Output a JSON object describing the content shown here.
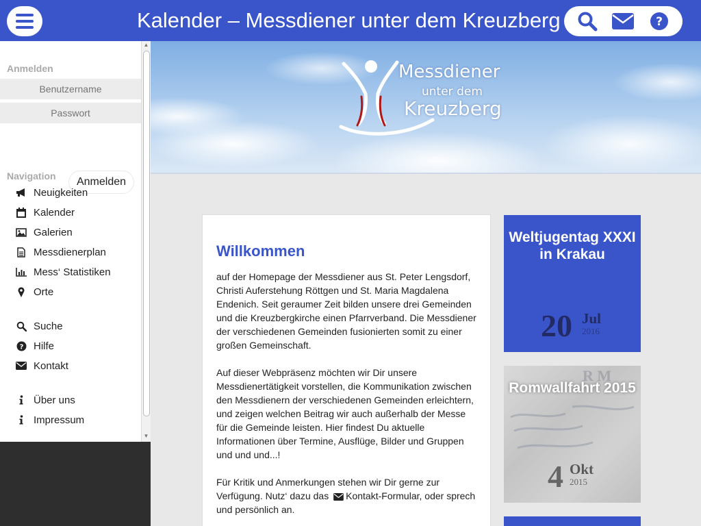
{
  "header": {
    "title": "Kalender – Messdiener unter dem Kreuzberg",
    "menu_icon": "bars-icon",
    "actions": [
      {
        "icon": "search-icon"
      },
      {
        "icon": "envelope-icon"
      },
      {
        "icon": "question-circle-icon"
      }
    ]
  },
  "sidebar": {
    "login_section": "Anmelden",
    "username_placeholder": "Benutzername",
    "password_placeholder": "Passwort",
    "login_button": "Anmelden",
    "nav_section": "Navigation",
    "items": [
      {
        "label": "Neuigkeiten",
        "icon": "bullhorn-icon"
      },
      {
        "label": "Kalender",
        "icon": "calendar-icon"
      },
      {
        "label": "Galerien",
        "icon": "image-icon"
      },
      {
        "label": "Messdienerplan",
        "icon": "file-text-icon"
      },
      {
        "label": "Mess‘ Statistiken",
        "icon": "bar-chart-icon"
      },
      {
        "label": "Orte",
        "icon": "map-marker-icon"
      },
      {
        "label": "Suche",
        "icon": "search-icon"
      },
      {
        "label": "Hilfe",
        "icon": "question-circle-icon"
      },
      {
        "label": "Kontakt",
        "icon": "envelope-icon"
      },
      {
        "label": "Über uns",
        "icon": "info-icon"
      },
      {
        "label": "Impressum",
        "icon": "info-icon"
      }
    ]
  },
  "banner": {
    "logo_line1": "Messdiener",
    "logo_line2": "unter dem",
    "logo_line3": "Kreuzberg"
  },
  "main": {
    "title": "Willkommen",
    "paragraph1": "auf der Homepage der Messdiener aus St. Peter Lengsdorf, Christi Auferstehung Röttgen und St. Maria Magdalena Endenich. Seit geraumer Zeit bilden unsere drei Gemeinden und die Kreuzbergkirche einen Pfarrverband. Die Messdiener der verschiedenen Gemeinden fusionierten somit zu einer großen Gemeinschaft.",
    "paragraph2": "Auf dieser Webpräsenz möchten wir Dir unsere Messdienertätigkeit vorstellen, die Kommunikation zwischen den Messdienern der verschiedenen Gemeinden erleichtern, und zeigen welchen Beitrag wir auch außerhalb der Messe für die Gemeinde leisten. Hier findest Du aktuelle Informationen über Termine, Ausflüge, Bilder und Gruppen und und und...!",
    "paragraph3_before": "Für Kritik und Anmerkungen stehen wir Dir gerne zur Verfügung. Nutz‘ dazu das",
    "paragraph3_link": "Kontakt-Formular",
    "paragraph3_after": ", oder sprech und persönlich an."
  },
  "events": [
    {
      "title": "Weltjugentag XXXI in Krakau",
      "day": "20",
      "month": "Jul",
      "year": "2016",
      "color": "#3a55c9"
    },
    {
      "title": "Romwallfahrt 2015",
      "day": "4",
      "month": "Okt",
      "year": "2015",
      "bg_letters": "R M"
    }
  ],
  "colors": {
    "accent": "#3a55c9",
    "date_text": "#222b66"
  }
}
